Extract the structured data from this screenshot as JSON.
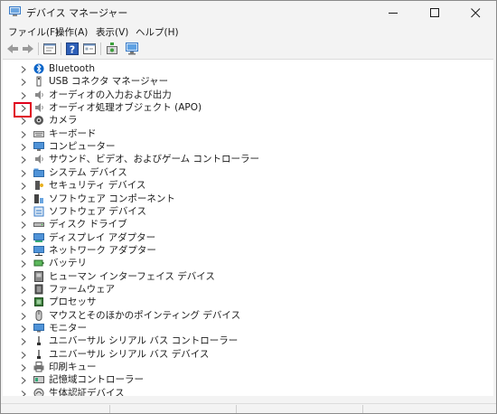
{
  "window": {
    "title": "デバイス マネージャー"
  },
  "menu": [
    {
      "label": "ファイル(F)"
    },
    {
      "label": "操作(A)"
    },
    {
      "label": "表示(V)"
    },
    {
      "label": "ヘルプ(H)"
    }
  ],
  "tree": {
    "items": [
      {
        "label": "Bluetooth",
        "icon": "bluetooth-icon"
      },
      {
        "label": "USB コネクタ マネージャー",
        "icon": "usb-connector-icon"
      },
      {
        "label": "オーディオの入力および出力",
        "icon": "speaker-icon"
      },
      {
        "label": "オーディオ処理オブジェクト (APO)",
        "icon": "speaker-icon"
      },
      {
        "label": "カメラ",
        "icon": "camera-icon"
      },
      {
        "label": "キーボード",
        "icon": "keyboard-icon"
      },
      {
        "label": "コンピューター",
        "icon": "computer-icon"
      },
      {
        "label": "サウンド、ビデオ、およびゲーム コントローラー",
        "icon": "speaker-icon"
      },
      {
        "label": "システム デバイス",
        "icon": "system-folder-icon"
      },
      {
        "label": "セキュリティ デバイス",
        "icon": "security-key-icon"
      },
      {
        "label": "ソフトウェア コンポーネント",
        "icon": "software-component-icon"
      },
      {
        "label": "ソフトウェア デバイス",
        "icon": "software-device-icon"
      },
      {
        "label": "ディスク ドライブ",
        "icon": "disk-drive-icon"
      },
      {
        "label": "ディスプレイ アダプター",
        "icon": "display-adapter-icon"
      },
      {
        "label": "ネットワーク アダプター",
        "icon": "network-adapter-icon"
      },
      {
        "label": "バッテリ",
        "icon": "battery-icon"
      },
      {
        "label": "ヒューマン インターフェイス デバイス",
        "icon": "hid-icon"
      },
      {
        "label": "ファームウェア",
        "icon": "firmware-icon"
      },
      {
        "label": "プロセッサ",
        "icon": "processor-icon"
      },
      {
        "label": "マウスとそのほかのポインティング デバイス",
        "icon": "mouse-icon"
      },
      {
        "label": "モニター",
        "icon": "monitor-icon"
      },
      {
        "label": "ユニバーサル シリアル バス コントローラー",
        "icon": "usb-icon"
      },
      {
        "label": "ユニバーサル シリアル バス デバイス",
        "icon": "usb-icon"
      },
      {
        "label": "印刷キュー",
        "icon": "printer-icon"
      },
      {
        "label": "記憶域コントローラー",
        "icon": "storage-controller-icon"
      },
      {
        "label": "生体認証デバイス",
        "icon": "biometric-icon"
      }
    ]
  },
  "colors": {
    "highlight": "#e0001b",
    "accent": "#0067c0"
  }
}
